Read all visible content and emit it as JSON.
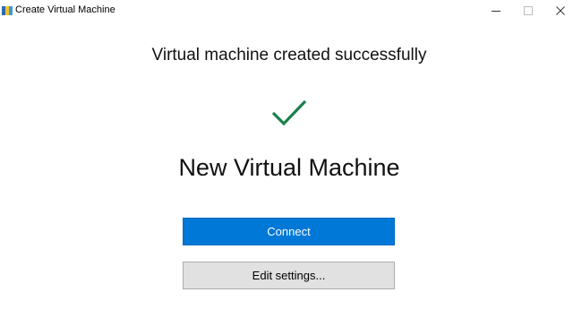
{
  "window": {
    "title": "Create Virtual Machine",
    "controls": {
      "minimize": "minimize-icon",
      "maximize": "maximize-icon",
      "close": "close-icon"
    }
  },
  "main": {
    "status_heading": "Virtual machine created successfully",
    "status_icon": "checkmark-icon",
    "vm_name": "New Virtual Machine",
    "connect_label": "Connect",
    "edit_settings_label": "Edit settings..."
  },
  "colors": {
    "accent": "#0078d7",
    "success": "#1a7f4b",
    "secondary_button": "#e1e1e1"
  }
}
